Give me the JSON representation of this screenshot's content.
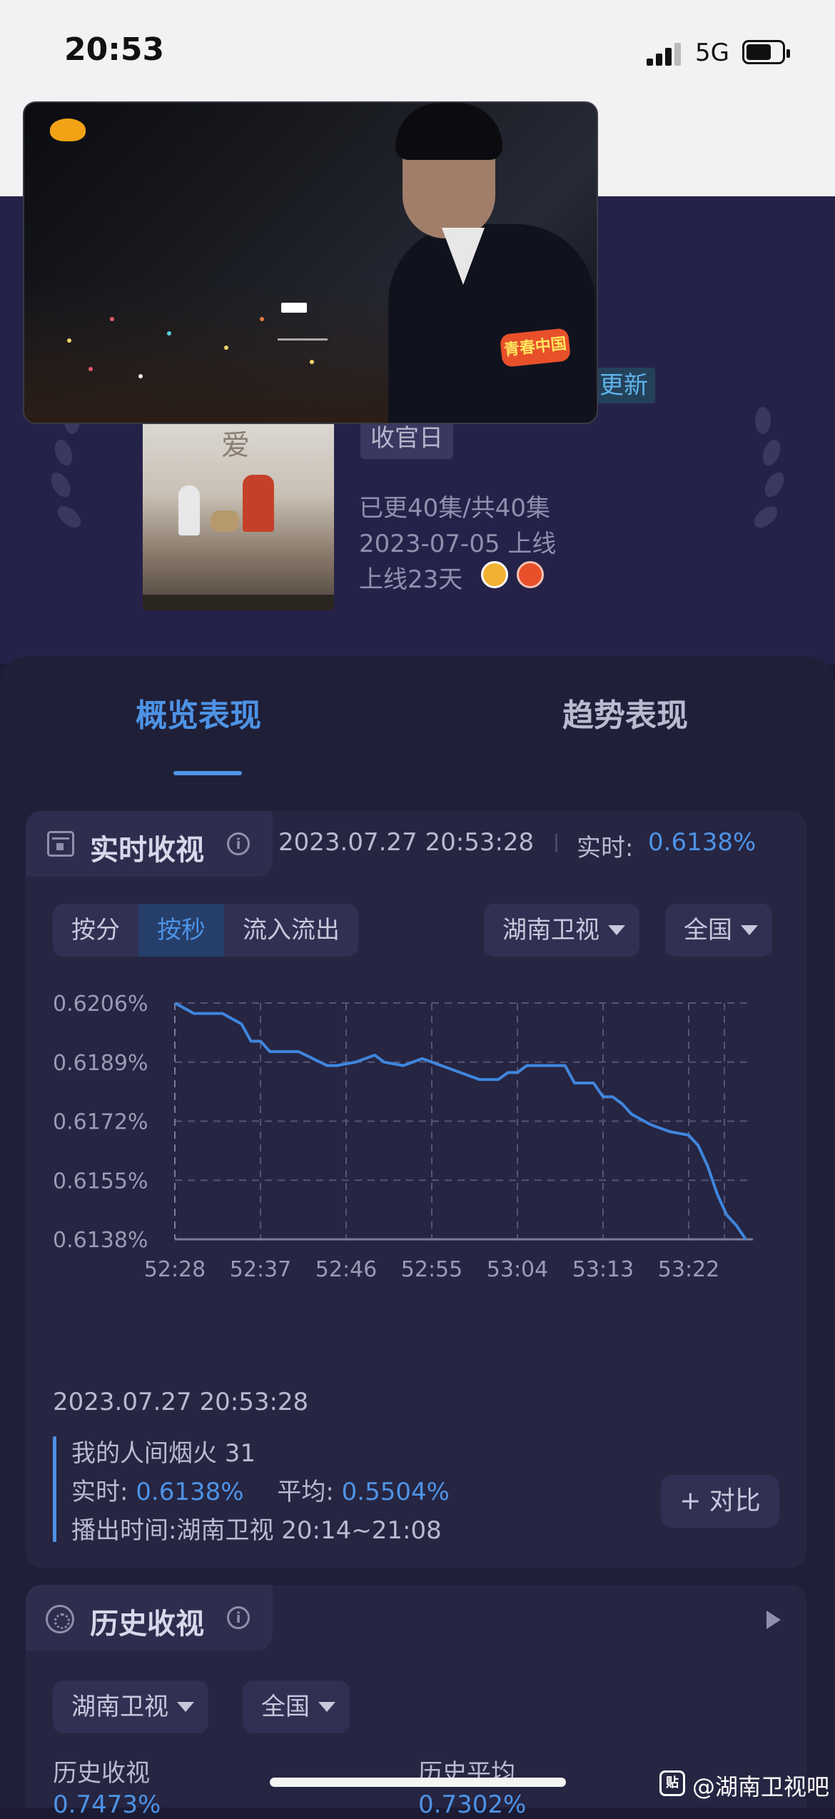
{
  "status_bar": {
    "time": "20:53",
    "network": "5G"
  },
  "show": {
    "update_tag": "更新",
    "finale_tag": "收官日",
    "episodes": "已更40集/共40集",
    "premiere": "2023-07-05 上线",
    "days_online": "上线23天",
    "poster_title": "爱",
    "video_badge": "青春中国"
  },
  "tabs": {
    "overview": "概览表现",
    "trend": "趋势表现"
  },
  "realtime": {
    "title": "实时收视",
    "timestamp": "2023.07.27 20:53:28",
    "label": "实时:",
    "value": "0.6138%",
    "modes": [
      "按分",
      "按秒",
      "流入流出"
    ],
    "active_mode": "按秒",
    "channel": "湖南卫视",
    "region": "全国"
  },
  "chart_data": {
    "type": "line",
    "x": [
      "52:28",
      "52:37",
      "52:46",
      "52:55",
      "53:04",
      "53:13",
      "53:22"
    ],
    "yticks": [
      "0.6206%",
      "0.6189%",
      "0.6172%",
      "0.6155%",
      "0.6138%"
    ],
    "ylim": [
      0.6138,
      0.6206
    ],
    "grid": true,
    "series": [
      {
        "values": [
          [
            0,
            0.6206
          ],
          [
            2,
            0.6203
          ],
          [
            5,
            0.6203
          ],
          [
            7,
            0.62
          ],
          [
            8,
            0.6195
          ],
          [
            9,
            0.6195
          ],
          [
            10,
            0.6192
          ],
          [
            13,
            0.6192
          ],
          [
            16,
            0.6188
          ],
          [
            17,
            0.6188
          ],
          [
            19,
            0.6189
          ],
          [
            21,
            0.6191
          ],
          [
            22,
            0.6189
          ],
          [
            24,
            0.6188
          ],
          [
            26,
            0.619
          ],
          [
            28,
            0.6188
          ],
          [
            30,
            0.6186
          ],
          [
            32,
            0.6184
          ],
          [
            34,
            0.6184
          ],
          [
            35,
            0.6186
          ],
          [
            36,
            0.6186
          ],
          [
            37,
            0.6188
          ],
          [
            39,
            0.6188
          ],
          [
            41,
            0.6188
          ],
          [
            42,
            0.6183
          ],
          [
            44,
            0.6183
          ],
          [
            45,
            0.6179
          ],
          [
            46,
            0.6179
          ],
          [
            47,
            0.6177
          ],
          [
            48,
            0.6174
          ],
          [
            50,
            0.6171
          ],
          [
            52,
            0.6169
          ],
          [
            54,
            0.6168
          ],
          [
            55,
            0.6165
          ],
          [
            56,
            0.6159
          ],
          [
            57,
            0.6151
          ],
          [
            58,
            0.6145
          ],
          [
            59,
            0.6142
          ],
          [
            60,
            0.6138
          ]
        ]
      }
    ]
  },
  "detail": {
    "timestamp": "2023.07.27 20:53:28",
    "program": "我的人间烟火 31",
    "rt_label": "实时:",
    "rt_value": "0.6138%",
    "avg_label": "平均:",
    "avg_value": "0.5504%",
    "airtime": "播出时间:湖南卫视 20:14~21:08",
    "compare": "+ 对比"
  },
  "history": {
    "title": "历史收视",
    "channel": "湖南卫视",
    "region": "全国",
    "label_left": "历史收视",
    "label_right": "历史平均",
    "value_left": "0.7473%",
    "value_right": "0.7302%"
  },
  "watermark": "@湖南卫视吧",
  "colors": {
    "accent": "#4d93e6",
    "panel": "#201f38",
    "card": "#262542"
  }
}
